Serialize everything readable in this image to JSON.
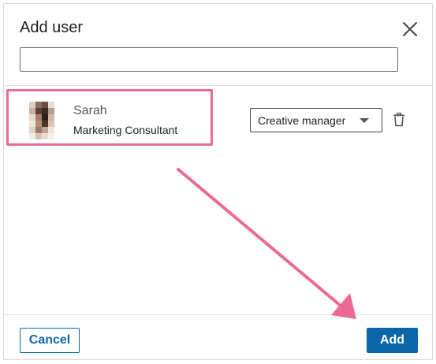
{
  "dialog": {
    "title": "Add user",
    "search": {
      "value": "",
      "placeholder": ""
    }
  },
  "icons": {
    "close": "close-icon",
    "delete": "trash-icon",
    "dropdown": "chevron-down-icon"
  },
  "selected_user": {
    "name": "Sarah",
    "headline": "Marketing Consultant",
    "role": "Creative manager"
  },
  "footer": {
    "cancel_label": "Cancel",
    "add_label": "Add"
  },
  "colors": {
    "primary": "#0a66a8",
    "annotation": "#ea6a95",
    "border": "#dddddd"
  }
}
